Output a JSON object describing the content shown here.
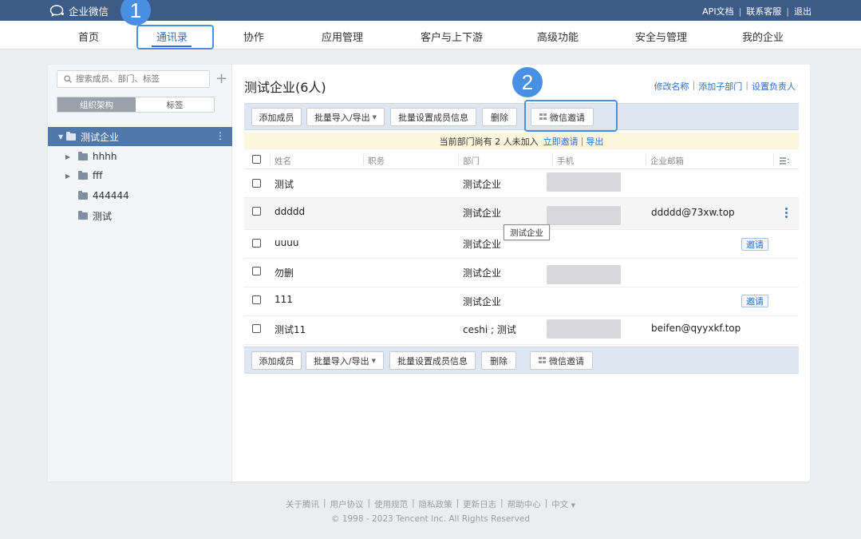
{
  "topbar": {
    "logo_text": "企业微信",
    "links": [
      "API文档",
      "联系客服",
      "退出"
    ]
  },
  "nav": {
    "items": [
      "首页",
      "通讯录",
      "协作",
      "应用管理",
      "客户与上下游",
      "高级功能",
      "安全与管理",
      "我的企业"
    ],
    "active_index": 1
  },
  "annotations": {
    "badge1": "1",
    "badge2": "2"
  },
  "sidebar": {
    "search_placeholder": "搜索成员、部门、标签",
    "segments": [
      "组织架构",
      "标签"
    ],
    "root": "测试企业",
    "nodes": [
      {
        "label": "hhhh",
        "expandable": true
      },
      {
        "label": "fff",
        "expandable": true
      },
      {
        "label": "444444",
        "expandable": false
      },
      {
        "label": "测试",
        "expandable": false
      }
    ]
  },
  "main": {
    "title": "测试企业(6人)",
    "title_links": [
      "修改名称",
      "添加子部门",
      "设置负责人"
    ],
    "toolbar": {
      "add_member": "添加成员",
      "import_export": "批量导入/导出",
      "batch_set": "批量设置成员信息",
      "delete": "删除",
      "wechat_invite": "微信邀请"
    },
    "notice": {
      "text": "当前部门尚有 2 人未加入",
      "invite": "立即邀请",
      "export": "导出",
      "sep": "|"
    },
    "columns": [
      "姓名",
      "职务",
      "部门",
      "手机",
      "企业邮箱"
    ],
    "rows": [
      {
        "name": "测试",
        "dept": "测试企业",
        "phone_masked": true,
        "email": "",
        "invite": ""
      },
      {
        "name": "ddddd",
        "dept": "测试企业",
        "phone_masked": true,
        "email": "ddddd@73xw.top",
        "invite": ""
      },
      {
        "name": "uuuu",
        "dept": "测试企业",
        "phone_masked": false,
        "email": "",
        "invite": "邀请"
      },
      {
        "name": "勿删",
        "dept": "测试企业",
        "phone_masked": true,
        "email": "",
        "invite": ""
      },
      {
        "name": "111",
        "dept": "测试企业",
        "phone_masked": false,
        "email": "",
        "invite": "邀请"
      },
      {
        "name": "测试11",
        "dept": "ceshi ; 测试",
        "phone_masked": true,
        "email": "beifen@qyyxkf.top",
        "invite": ""
      }
    ],
    "tooltip": "测试企业"
  },
  "footer": {
    "links": [
      "关于腾讯",
      "用户协议",
      "使用规范",
      "隐私政策",
      "更新日志",
      "帮助中心",
      "中文"
    ],
    "copyright": "© 1998 - 2023 Tencent Inc. All Rights Reserved"
  },
  "colors": {
    "topbar": "#3c5b87",
    "accent": "#4a90e2",
    "link": "#2f6fc7",
    "tree_selected": "#4f78ad"
  }
}
